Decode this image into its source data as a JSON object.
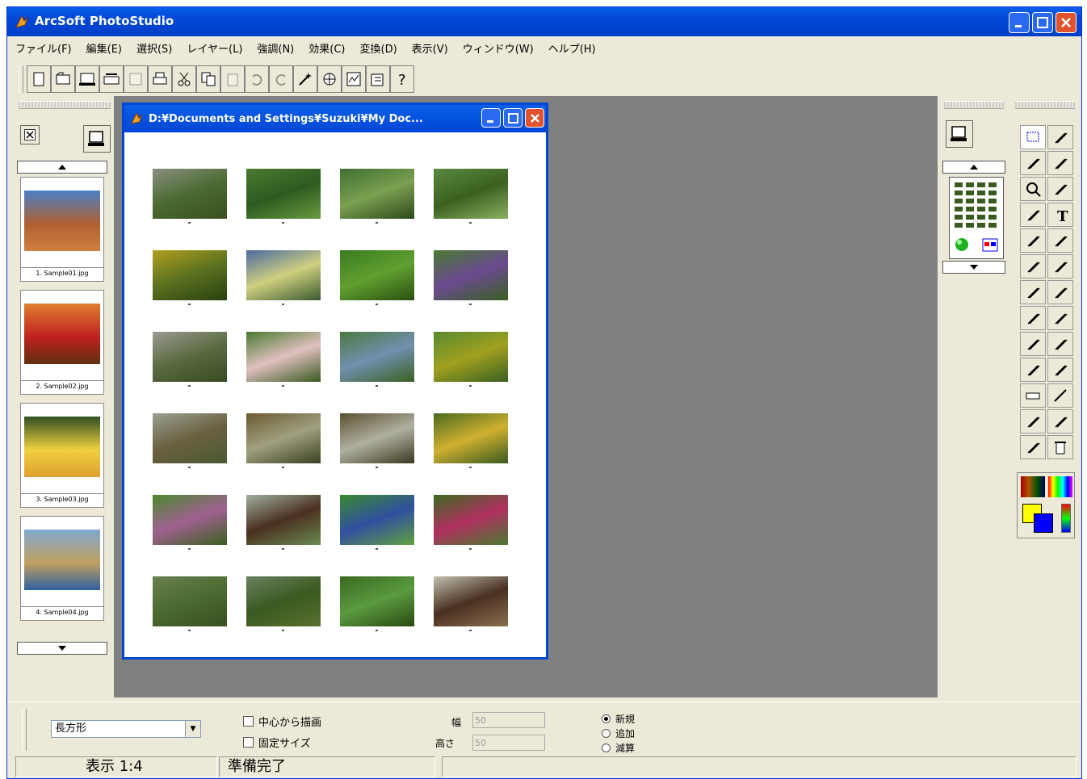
{
  "app": {
    "title": "ArcSoft PhotoStudio",
    "colors": {
      "titlebar": "#0046d5",
      "workspace": "#808080",
      "window_bg": "#ece9d8"
    }
  },
  "menubar": {
    "items": [
      "ファイル(F)",
      "編集(E)",
      "選択(S)",
      "レイヤー(L)",
      "強調(N)",
      "効果(C)",
      "変換(D)",
      "表示(V)",
      "ウィンドウ(W)",
      "ヘルプ(H)"
    ]
  },
  "toolbar": {
    "buttons": [
      {
        "icon": "new-document-icon",
        "enabled": true
      },
      {
        "icon": "open-icon",
        "enabled": true
      },
      {
        "icon": "acquire-icon",
        "enabled": true
      },
      {
        "icon": "scanner-icon",
        "enabled": true
      },
      {
        "icon": "save-icon",
        "enabled": false
      },
      {
        "icon": "print-icon",
        "enabled": true
      },
      {
        "icon": "cut-icon",
        "enabled": true
      },
      {
        "icon": "copy-icon",
        "enabled": true
      },
      {
        "icon": "paste-icon",
        "enabled": false
      },
      {
        "icon": "undo-icon",
        "enabled": false
      },
      {
        "icon": "redo-icon",
        "enabled": false
      },
      {
        "icon": "magic-wand-icon",
        "enabled": true
      },
      {
        "icon": "effects-icon",
        "enabled": true
      },
      {
        "icon": "adjust-icon",
        "enabled": true
      },
      {
        "icon": "batch-icon",
        "enabled": true
      },
      {
        "icon": "help-icon",
        "enabled": true
      }
    ]
  },
  "album": {
    "items": [
      {
        "label": "1. Sample01.jpg"
      },
      {
        "label": "2. Sample02.jpg"
      },
      {
        "label": "3. Sample03.jpg"
      },
      {
        "label": "4. Sample04.jpg"
      }
    ]
  },
  "document": {
    "title": "D:¥Documents and Settings¥Suzuki¥My Doc..."
  },
  "contact_sheet": {
    "rows": 6,
    "cols": 4
  },
  "options": {
    "shape_select": "長方形",
    "checkbox_center": "中心から描画",
    "checkbox_fixed": "固定サイズ",
    "width_label": "幅",
    "width_value": "50",
    "height_label": "高さ",
    "height_value": "50",
    "radio_new": "新規",
    "radio_add": "追加",
    "radio_subtract": "減算"
  },
  "status": {
    "zoom": "表示 1:4",
    "message": "準備完了"
  }
}
